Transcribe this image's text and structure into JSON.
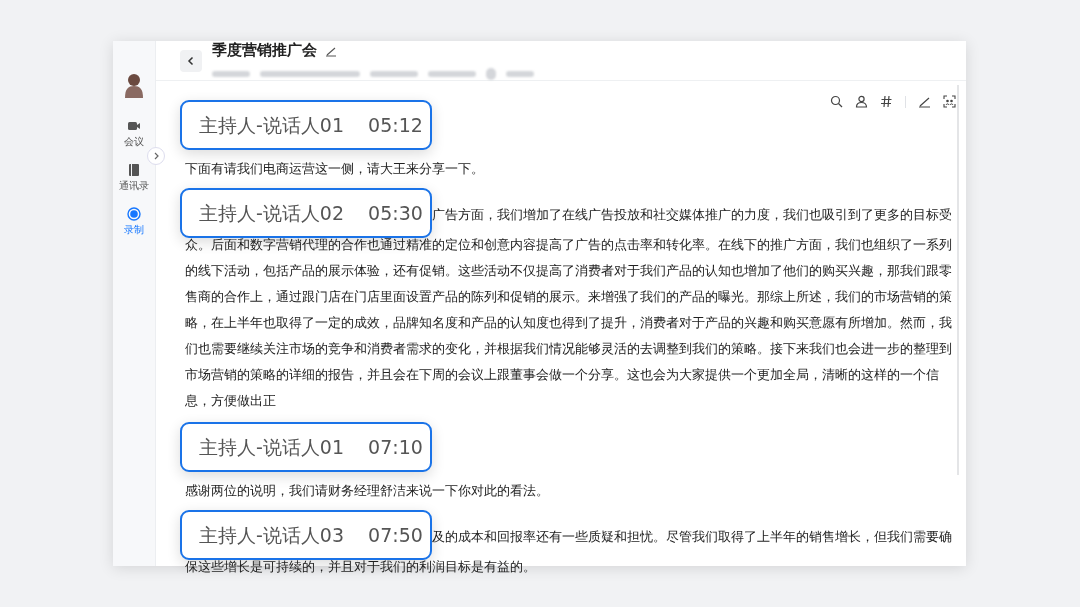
{
  "sidebar": {
    "items": [
      {
        "label": "会议",
        "selected": false
      },
      {
        "label": "通讯录",
        "selected": false
      },
      {
        "label": "录制",
        "selected": true
      }
    ]
  },
  "header": {
    "title": "季度营销推广会"
  },
  "segments": [
    {
      "speaker": "主持人-说话人01",
      "time": "05:12",
      "text": "下面有请我们电商运营这一侧，请大王来分享一下。"
    },
    {
      "speaker": "主持人-说话人02",
      "time": "05:30",
      "lead": "广告方面，我们增加了在线广告投放和社交媒体推广的力度，我们也吸引到了更多的目标受",
      "text": "众。后面和数字营销代理的合作也通过精准的定位和创意内容提高了广告的点击率和转化率。在线下的推广方面，我们也组织了一系列的线下活动，包括产品的展示体验，还有促销。这些活动不仅提高了消费者对于我们产品的认知也增加了他们的购买兴趣，那我们跟零售商的合作上，通过跟门店在门店里面设置产品的陈列和促销的展示。来增强了我们的产品的曝光。那综上所述，我们的市场营销的策略，在上半年也取得了一定的成效，品牌知名度和产品的认知度也得到了提升，消费者对于产品的兴趣和购买意愿有所增加。然而，我们也需要继续关注市场的竞争和消费者需求的变化，并根据我们情况能够灵活的去调整到我们的策略。接下来我们也会进一步的整理到市场营销的策略的详细的报告，并且会在下周的会议上跟董事会做一个分享。这也会为大家提供一个更加全局，清晰的这样的一个信息，方便做出正"
    },
    {
      "speaker": "主持人-说话人01",
      "time": "07:10",
      "text": "感谢两位的说明，我们请财务经理舒洁来说一下你对此的看法。"
    },
    {
      "speaker": "主持人-说话人03",
      "time": "07:50",
      "lead": "及的成本和回报率还有一些质疑和担忧。尽管我们取得了上半年的销售增长，但我们需要确",
      "text": "保这些增长是可持续的，并且对于我们的利润目标是有益的。"
    }
  ]
}
